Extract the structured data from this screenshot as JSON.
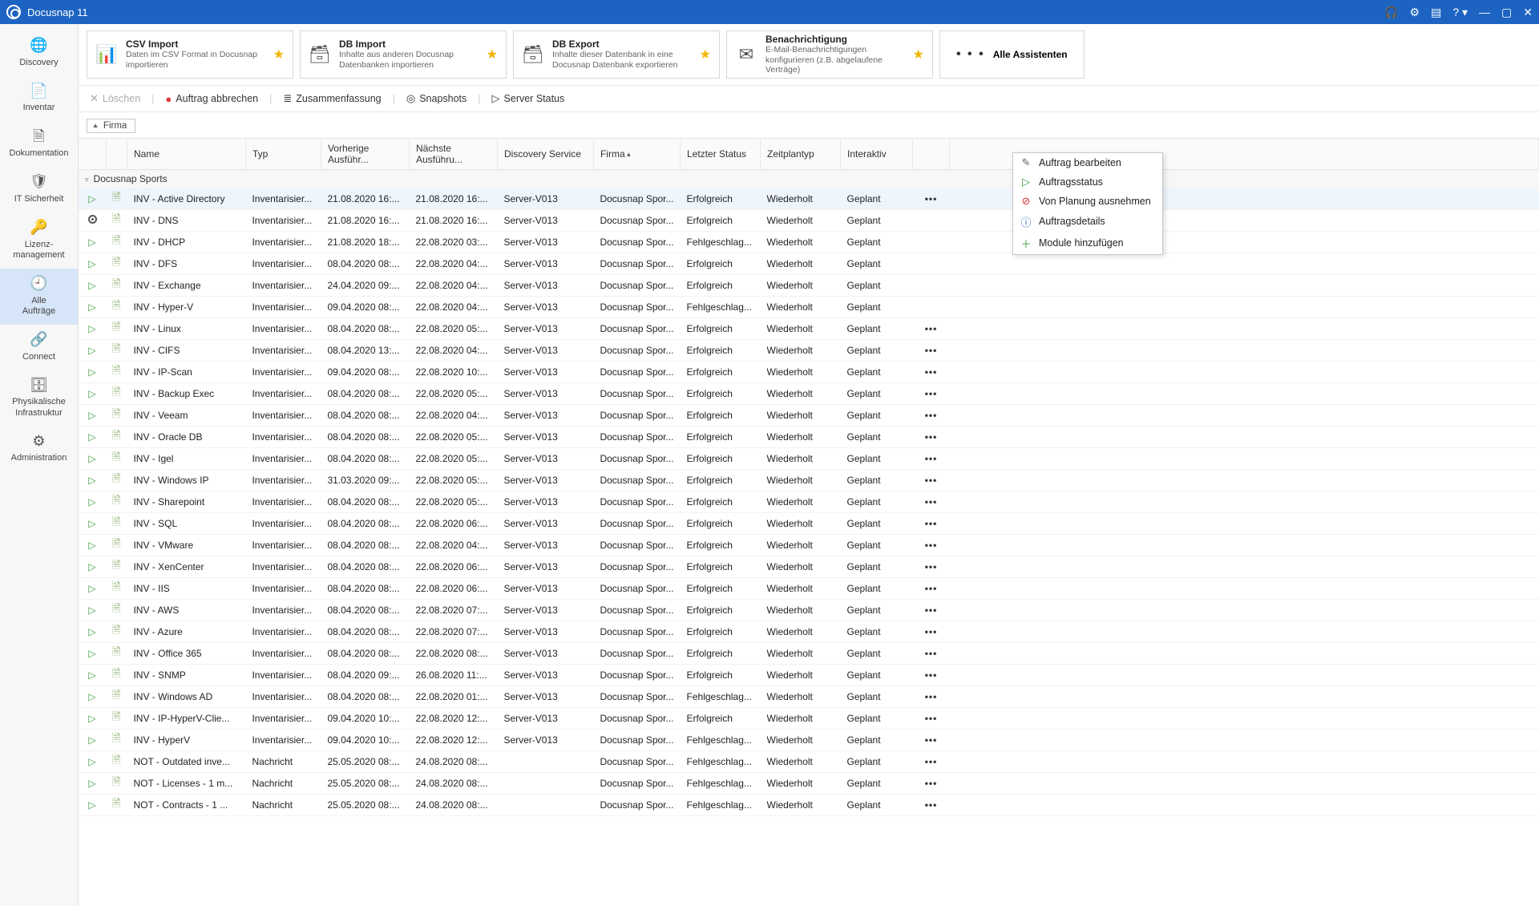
{
  "titlebar": {
    "title": "Docusnap 11"
  },
  "sidebar": {
    "items": [
      {
        "icon": "🌐",
        "label": "Discovery"
      },
      {
        "icon": "📄",
        "label": "Inventar"
      },
      {
        "icon": "🗎",
        "label": "Dokumentation"
      },
      {
        "icon": "🛡",
        "label": "IT Sicherheit"
      },
      {
        "icon": "🔑",
        "label": "Lizenz-\nmanagement"
      },
      {
        "icon": "🕘",
        "label": "Alle\nAufträge"
      },
      {
        "icon": "🔗",
        "label": "Connect"
      },
      {
        "icon": "🗄",
        "label": "Physikalische\nInfrastruktur"
      },
      {
        "icon": "⚙",
        "label": "Administration"
      }
    ],
    "active_index": 5
  },
  "cards": [
    {
      "icon": "csv",
      "title": "CSV Import",
      "desc": "Daten im CSV Format in Docusnap importieren",
      "star": true
    },
    {
      "icon": "db-in",
      "title": "DB Import",
      "desc": "Inhalte aus anderen Docusnap Datenbanken importieren",
      "star": true
    },
    {
      "icon": "db-out",
      "title": "DB Export",
      "desc": "Inhalte dieser Datenbank in eine Docusnap Datenbank exportieren",
      "star": true
    },
    {
      "icon": "mail",
      "title": "Benachrichtigung",
      "desc": "E-Mail-Benachrichtigungen konfigurieren (z.B. abgelaufene Verträge)",
      "star": true
    }
  ],
  "card_all": {
    "label": "Alle Assistenten"
  },
  "actionbar": {
    "delete": "Löschen",
    "cancel": "Auftrag abbrechen",
    "summary": "Zusammenfassung",
    "snapshots": "Snapshots",
    "server_status": "Server Status"
  },
  "group_chip": "Firma",
  "columns": [
    "",
    "",
    "Name",
    "Typ",
    "Vorherige Ausführ...",
    "Nächste Ausführu...",
    "Discovery Service",
    "Firma",
    "Letzter Status",
    "Zeitplantyp",
    "Interaktiv",
    "",
    ""
  ],
  "sorted_column_index": 7,
  "group_header": "Docusnap Sports",
  "rows": [
    {
      "play": true,
      "name": "INV - Active Directory",
      "typ": "Inventarisier...",
      "prev": "21.08.2020 16:...",
      "next": "21.08.2020 16:...",
      "svc": "Server-V013",
      "firma": "Docusnap Spor...",
      "status": "Erfolgreich",
      "plan": "Wiederholt",
      "inter": "Geplant",
      "selected": true,
      "actions": true
    },
    {
      "radio": true,
      "name": "INV - DNS",
      "typ": "Inventarisier...",
      "prev": "21.08.2020 16:...",
      "next": "21.08.2020 16:...",
      "svc": "Server-V013",
      "firma": "Docusnap Spor...",
      "status": "Erfolgreich",
      "plan": "Wiederholt",
      "inter": "Geplant"
    },
    {
      "play": true,
      "name": "INV - DHCP",
      "typ": "Inventarisier...",
      "prev": "21.08.2020 18:...",
      "next": "22.08.2020 03:...",
      "svc": "Server-V013",
      "firma": "Docusnap Spor...",
      "status": "Fehlgeschlag...",
      "plan": "Wiederholt",
      "inter": "Geplant"
    },
    {
      "play": true,
      "name": "INV - DFS",
      "typ": "Inventarisier...",
      "prev": "08.04.2020 08:...",
      "next": "22.08.2020 04:...",
      "svc": "Server-V013",
      "firma": "Docusnap Spor...",
      "status": "Erfolgreich",
      "plan": "Wiederholt",
      "inter": "Geplant"
    },
    {
      "play": true,
      "name": "INV - Exchange",
      "typ": "Inventarisier...",
      "prev": "24.04.2020 09:...",
      "next": "22.08.2020 04:...",
      "svc": "Server-V013",
      "firma": "Docusnap Spor...",
      "status": "Erfolgreich",
      "plan": "Wiederholt",
      "inter": "Geplant"
    },
    {
      "play": true,
      "name": "INV - Hyper-V",
      "typ": "Inventarisier...",
      "prev": "09.04.2020 08:...",
      "next": "22.08.2020 04:...",
      "svc": "Server-V013",
      "firma": "Docusnap Spor...",
      "status": "Fehlgeschlag...",
      "plan": "Wiederholt",
      "inter": "Geplant"
    },
    {
      "play": true,
      "name": "INV - Linux",
      "typ": "Inventarisier...",
      "prev": "08.04.2020 08:...",
      "next": "22.08.2020 05:...",
      "svc": "Server-V013",
      "firma": "Docusnap Spor...",
      "status": "Erfolgreich",
      "plan": "Wiederholt",
      "inter": "Geplant",
      "actions": true
    },
    {
      "play": true,
      "name": "INV - CIFS",
      "typ": "Inventarisier...",
      "prev": "08.04.2020 13:...",
      "next": "22.08.2020 04:...",
      "svc": "Server-V013",
      "firma": "Docusnap Spor...",
      "status": "Erfolgreich",
      "plan": "Wiederholt",
      "inter": "Geplant",
      "actions": true
    },
    {
      "play": true,
      "name": "INV - IP-Scan",
      "typ": "Inventarisier...",
      "prev": "09.04.2020 08:...",
      "next": "22.08.2020 10:...",
      "svc": "Server-V013",
      "firma": "Docusnap Spor...",
      "status": "Erfolgreich",
      "plan": "Wiederholt",
      "inter": "Geplant",
      "actions": true
    },
    {
      "play": true,
      "name": "INV - Backup Exec",
      "typ": "Inventarisier...",
      "prev": "08.04.2020 08:...",
      "next": "22.08.2020 05:...",
      "svc": "Server-V013",
      "firma": "Docusnap Spor...",
      "status": "Erfolgreich",
      "plan": "Wiederholt",
      "inter": "Geplant",
      "actions": true
    },
    {
      "play": true,
      "name": "INV - Veeam",
      "typ": "Inventarisier...",
      "prev": "08.04.2020 08:...",
      "next": "22.08.2020 04:...",
      "svc": "Server-V013",
      "firma": "Docusnap Spor...",
      "status": "Erfolgreich",
      "plan": "Wiederholt",
      "inter": "Geplant",
      "actions": true
    },
    {
      "play": true,
      "name": "INV - Oracle DB",
      "typ": "Inventarisier...",
      "prev": "08.04.2020 08:...",
      "next": "22.08.2020 05:...",
      "svc": "Server-V013",
      "firma": "Docusnap Spor...",
      "status": "Erfolgreich",
      "plan": "Wiederholt",
      "inter": "Geplant",
      "actions": true
    },
    {
      "play": true,
      "name": "INV - Igel",
      "typ": "Inventarisier...",
      "prev": "08.04.2020 08:...",
      "next": "22.08.2020 05:...",
      "svc": "Server-V013",
      "firma": "Docusnap Spor...",
      "status": "Erfolgreich",
      "plan": "Wiederholt",
      "inter": "Geplant",
      "actions": true
    },
    {
      "play": true,
      "name": "INV - Windows IP",
      "typ": "Inventarisier...",
      "prev": "31.03.2020 09:...",
      "next": "22.08.2020 05:...",
      "svc": "Server-V013",
      "firma": "Docusnap Spor...",
      "status": "Erfolgreich",
      "plan": "Wiederholt",
      "inter": "Geplant",
      "actions": true
    },
    {
      "play": true,
      "name": "INV - Sharepoint",
      "typ": "Inventarisier...",
      "prev": "08.04.2020 08:...",
      "next": "22.08.2020 05:...",
      "svc": "Server-V013",
      "firma": "Docusnap Spor...",
      "status": "Erfolgreich",
      "plan": "Wiederholt",
      "inter": "Geplant",
      "actions": true
    },
    {
      "play": true,
      "name": "INV - SQL",
      "typ": "Inventarisier...",
      "prev": "08.04.2020 08:...",
      "next": "22.08.2020 06:...",
      "svc": "Server-V013",
      "firma": "Docusnap Spor...",
      "status": "Erfolgreich",
      "plan": "Wiederholt",
      "inter": "Geplant",
      "actions": true
    },
    {
      "play": true,
      "name": "INV - VMware",
      "typ": "Inventarisier...",
      "prev": "08.04.2020 08:...",
      "next": "22.08.2020 04:...",
      "svc": "Server-V013",
      "firma": "Docusnap Spor...",
      "status": "Erfolgreich",
      "plan": "Wiederholt",
      "inter": "Geplant",
      "actions": true
    },
    {
      "play": true,
      "name": "INV - XenCenter",
      "typ": "Inventarisier...",
      "prev": "08.04.2020 08:...",
      "next": "22.08.2020 06:...",
      "svc": "Server-V013",
      "firma": "Docusnap Spor...",
      "status": "Erfolgreich",
      "plan": "Wiederholt",
      "inter": "Geplant",
      "actions": true
    },
    {
      "play": true,
      "name": "INV - IIS",
      "typ": "Inventarisier...",
      "prev": "08.04.2020 08:...",
      "next": "22.08.2020 06:...",
      "svc": "Server-V013",
      "firma": "Docusnap Spor...",
      "status": "Erfolgreich",
      "plan": "Wiederholt",
      "inter": "Geplant",
      "actions": true
    },
    {
      "play": true,
      "name": "INV - AWS",
      "typ": "Inventarisier...",
      "prev": "08.04.2020 08:...",
      "next": "22.08.2020 07:...",
      "svc": "Server-V013",
      "firma": "Docusnap Spor...",
      "status": "Erfolgreich",
      "plan": "Wiederholt",
      "inter": "Geplant",
      "actions": true
    },
    {
      "play": true,
      "name": "INV - Azure",
      "typ": "Inventarisier...",
      "prev": "08.04.2020 08:...",
      "next": "22.08.2020 07:...",
      "svc": "Server-V013",
      "firma": "Docusnap Spor...",
      "status": "Erfolgreich",
      "plan": "Wiederholt",
      "inter": "Geplant",
      "actions": true
    },
    {
      "play": true,
      "name": "INV - Office 365",
      "typ": "Inventarisier...",
      "prev": "08.04.2020 08:...",
      "next": "22.08.2020 08:...",
      "svc": "Server-V013",
      "firma": "Docusnap Spor...",
      "status": "Erfolgreich",
      "plan": "Wiederholt",
      "inter": "Geplant",
      "actions": true
    },
    {
      "play": true,
      "name": "INV - SNMP",
      "typ": "Inventarisier...",
      "prev": "08.04.2020 09:...",
      "next": "26.08.2020 11:...",
      "svc": "Server-V013",
      "firma": "Docusnap Spor...",
      "status": "Erfolgreich",
      "plan": "Wiederholt",
      "inter": "Geplant",
      "actions": true
    },
    {
      "play": true,
      "name": "INV - Windows AD",
      "typ": "Inventarisier...",
      "prev": "08.04.2020 08:...",
      "next": "22.08.2020 01:...",
      "svc": "Server-V013",
      "firma": "Docusnap Spor...",
      "status": "Fehlgeschlag...",
      "plan": "Wiederholt",
      "inter": "Geplant",
      "actions": true
    },
    {
      "play": true,
      "name": "INV - IP-HyperV-Clie...",
      "typ": "Inventarisier...",
      "prev": "09.04.2020 10:...",
      "next": "22.08.2020 12:...",
      "svc": "Server-V013",
      "firma": "Docusnap Spor...",
      "status": "Erfolgreich",
      "plan": "Wiederholt",
      "inter": "Geplant",
      "actions": true
    },
    {
      "play": true,
      "name": "INV - HyperV",
      "typ": "Inventarisier...",
      "prev": "09.04.2020 10:...",
      "next": "22.08.2020 12:...",
      "svc": "Server-V013",
      "firma": "Docusnap Spor...",
      "status": "Fehlgeschlag...",
      "plan": "Wiederholt",
      "inter": "Geplant",
      "actions": true
    },
    {
      "play": true,
      "name": "NOT - Outdated inve...",
      "typ": "Nachricht",
      "prev": "25.05.2020 08:...",
      "next": "24.08.2020 08:...",
      "svc": "",
      "firma": "Docusnap Spor...",
      "status": "Fehlgeschlag...",
      "plan": "Wiederholt",
      "inter": "Geplant",
      "actions": true
    },
    {
      "play": true,
      "name": "NOT - Licenses - 1 m...",
      "typ": "Nachricht",
      "prev": "25.05.2020 08:...",
      "next": "24.08.2020 08:...",
      "svc": "",
      "firma": "Docusnap Spor...",
      "status": "Fehlgeschlag...",
      "plan": "Wiederholt",
      "inter": "Geplant",
      "actions": true
    },
    {
      "play": true,
      "name": "NOT - Contracts - 1 ...",
      "typ": "Nachricht",
      "prev": "25.05.2020 08:...",
      "next": "24.08.2020 08:...",
      "svc": "",
      "firma": "Docusnap Spor...",
      "status": "Fehlgeschlag...",
      "plan": "Wiederholt",
      "inter": "Geplant",
      "actions": true
    }
  ],
  "context_menu": {
    "visible": true,
    "items": [
      {
        "icon": "edit",
        "glyph": "✎",
        "label": "Auftrag bearbeiten"
      },
      {
        "icon": "play",
        "glyph": "▷",
        "label": "Auftragsstatus"
      },
      {
        "icon": "exclude",
        "glyph": "⊘",
        "label": "Von Planung ausnehmen"
      },
      {
        "icon": "info",
        "glyph": "ⓘ",
        "label": "Auftragsdetails"
      },
      {
        "icon": "plus",
        "glyph": "＋",
        "label": "Module hinzufügen"
      }
    ]
  }
}
